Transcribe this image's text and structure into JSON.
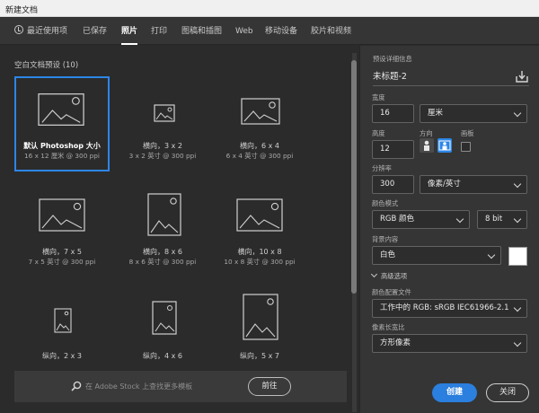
{
  "window": {
    "title": "新建文档"
  },
  "tabs": [
    {
      "label": "最近使用项"
    },
    {
      "label": "已保存"
    },
    {
      "label": "照片",
      "active": true
    },
    {
      "label": "打印"
    },
    {
      "label": "图稿和插图"
    },
    {
      "label": "Web"
    },
    {
      "label": "移动设备"
    },
    {
      "label": "胶片和视频"
    }
  ],
  "presets": {
    "section_title": "空白文档预设 (10)",
    "items": [
      {
        "name": "默认 Photoshop 大小",
        "size": "16 x 12 厘米 @ 300 ppi",
        "selected": true,
        "orientation": "landscape-large"
      },
      {
        "name": "横向，3 x 2",
        "size": "3 x 2 英寸 @ 300 ppi",
        "orientation": "landscape-small"
      },
      {
        "name": "横向，6 x 4",
        "size": "6 x 4 英寸 @ 300 ppi",
        "orientation": "landscape-large"
      },
      {
        "name": "横向，7 x 5",
        "size": "7 x 5 英寸 @ 300 ppi",
        "orientation": "landscape-large"
      },
      {
        "name": "横向，8 x 6",
        "size": "8 x 6 英寸 @ 300 ppi",
        "orientation": "portrait-large"
      },
      {
        "name": "横向，10 x 8",
        "size": "10 x 8 英寸 @ 300 ppi",
        "orientation": "landscape-large"
      },
      {
        "name": "纵向，2 x 3",
        "size": "",
        "orientation": "portrait-small"
      },
      {
        "name": "纵向，4 x 6",
        "size": "",
        "orientation": "portrait-medium"
      },
      {
        "name": "纵向，5 x 7",
        "size": "",
        "orientation": "portrait-large"
      }
    ]
  },
  "stock": {
    "placeholder": "在 Adobe Stock 上查找更多模板",
    "go_label": "前往"
  },
  "details": {
    "header": "预设详细信息",
    "doc_name": "未标题-2",
    "width_label": "宽度",
    "width_value": "16",
    "width_unit": "厘米",
    "height_label": "高度",
    "height_value": "12",
    "orientation_label": "方向",
    "artboard_label": "画板",
    "resolution_label": "分辨率",
    "resolution_value": "300",
    "resolution_unit": "像素/英寸",
    "color_mode_label": "颜色模式",
    "color_mode_value": "RGB 颜色",
    "bit_depth": "8 bit",
    "bg_label": "背景内容",
    "bg_value": "白色",
    "bg_swatch_color": "#ffffff",
    "advanced_label": "高级选项",
    "profile_label": "颜色配置文件",
    "profile_value": "工作中的 RGB: sRGB IEC61966-2.1",
    "pixel_aspect_label": "像素长宽比",
    "pixel_aspect_value": "方形像素"
  },
  "actions": {
    "create": "创建",
    "close": "关闭"
  },
  "colors": {
    "accent": "#2d86e6"
  }
}
